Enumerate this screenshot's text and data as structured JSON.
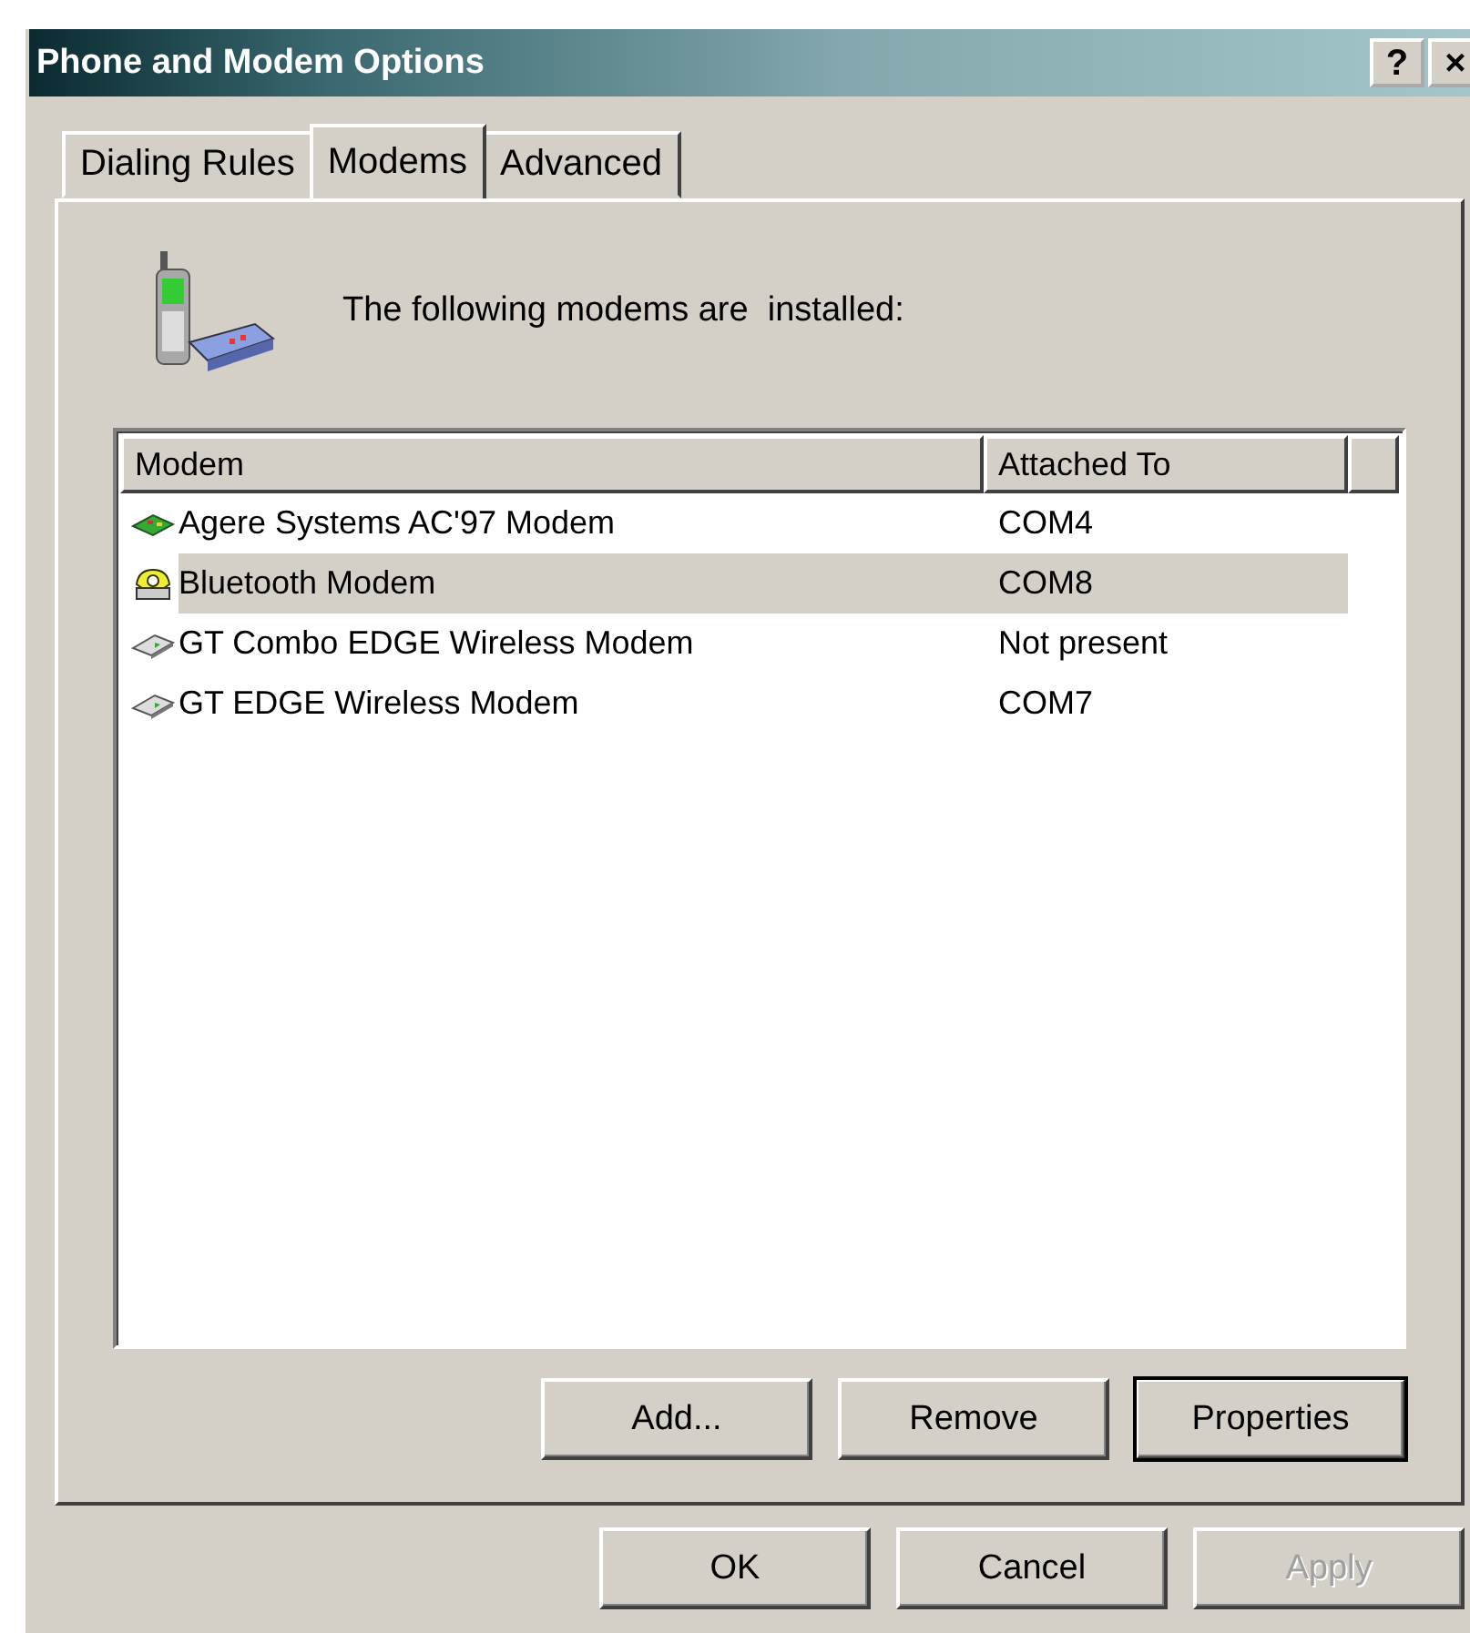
{
  "window": {
    "title": "Phone and Modem Options",
    "title_buttons": [
      "?",
      "×"
    ]
  },
  "tabs": [
    {
      "label": "Dialing Rules",
      "selected": false
    },
    {
      "label": "Modems",
      "selected": true
    },
    {
      "label": "Advanced",
      "selected": false
    }
  ],
  "intro": "The following modems are  installed:",
  "table": {
    "columns": [
      "Modem",
      "Attached To"
    ],
    "rows": [
      {
        "kind": "card",
        "modem": "Agere Systems AC'97 Modem",
        "attached_to": "COM4",
        "selected": false
      },
      {
        "kind": "phone",
        "modem": "Bluetooth Modem",
        "attached_to": "COM8",
        "selected": true
      },
      {
        "kind": "pccard",
        "modem": "GT Combo EDGE Wireless Modem",
        "attached_to": "Not present",
        "selected": false
      },
      {
        "kind": "pccard",
        "modem": "GT EDGE Wireless Modem",
        "attached_to": "COM7",
        "selected": false
      }
    ]
  },
  "panel_buttons": [
    {
      "label": "Add...",
      "default": false,
      "disabled": false
    },
    {
      "label": "Remove",
      "default": false,
      "disabled": false
    },
    {
      "label": "Properties",
      "default": true,
      "disabled": false
    }
  ],
  "dialog_buttons": [
    {
      "label": "OK",
      "default": false,
      "disabled": false
    },
    {
      "label": "Cancel",
      "default": false,
      "disabled": false
    },
    {
      "label": "Apply",
      "default": false,
      "disabled": true
    }
  ]
}
